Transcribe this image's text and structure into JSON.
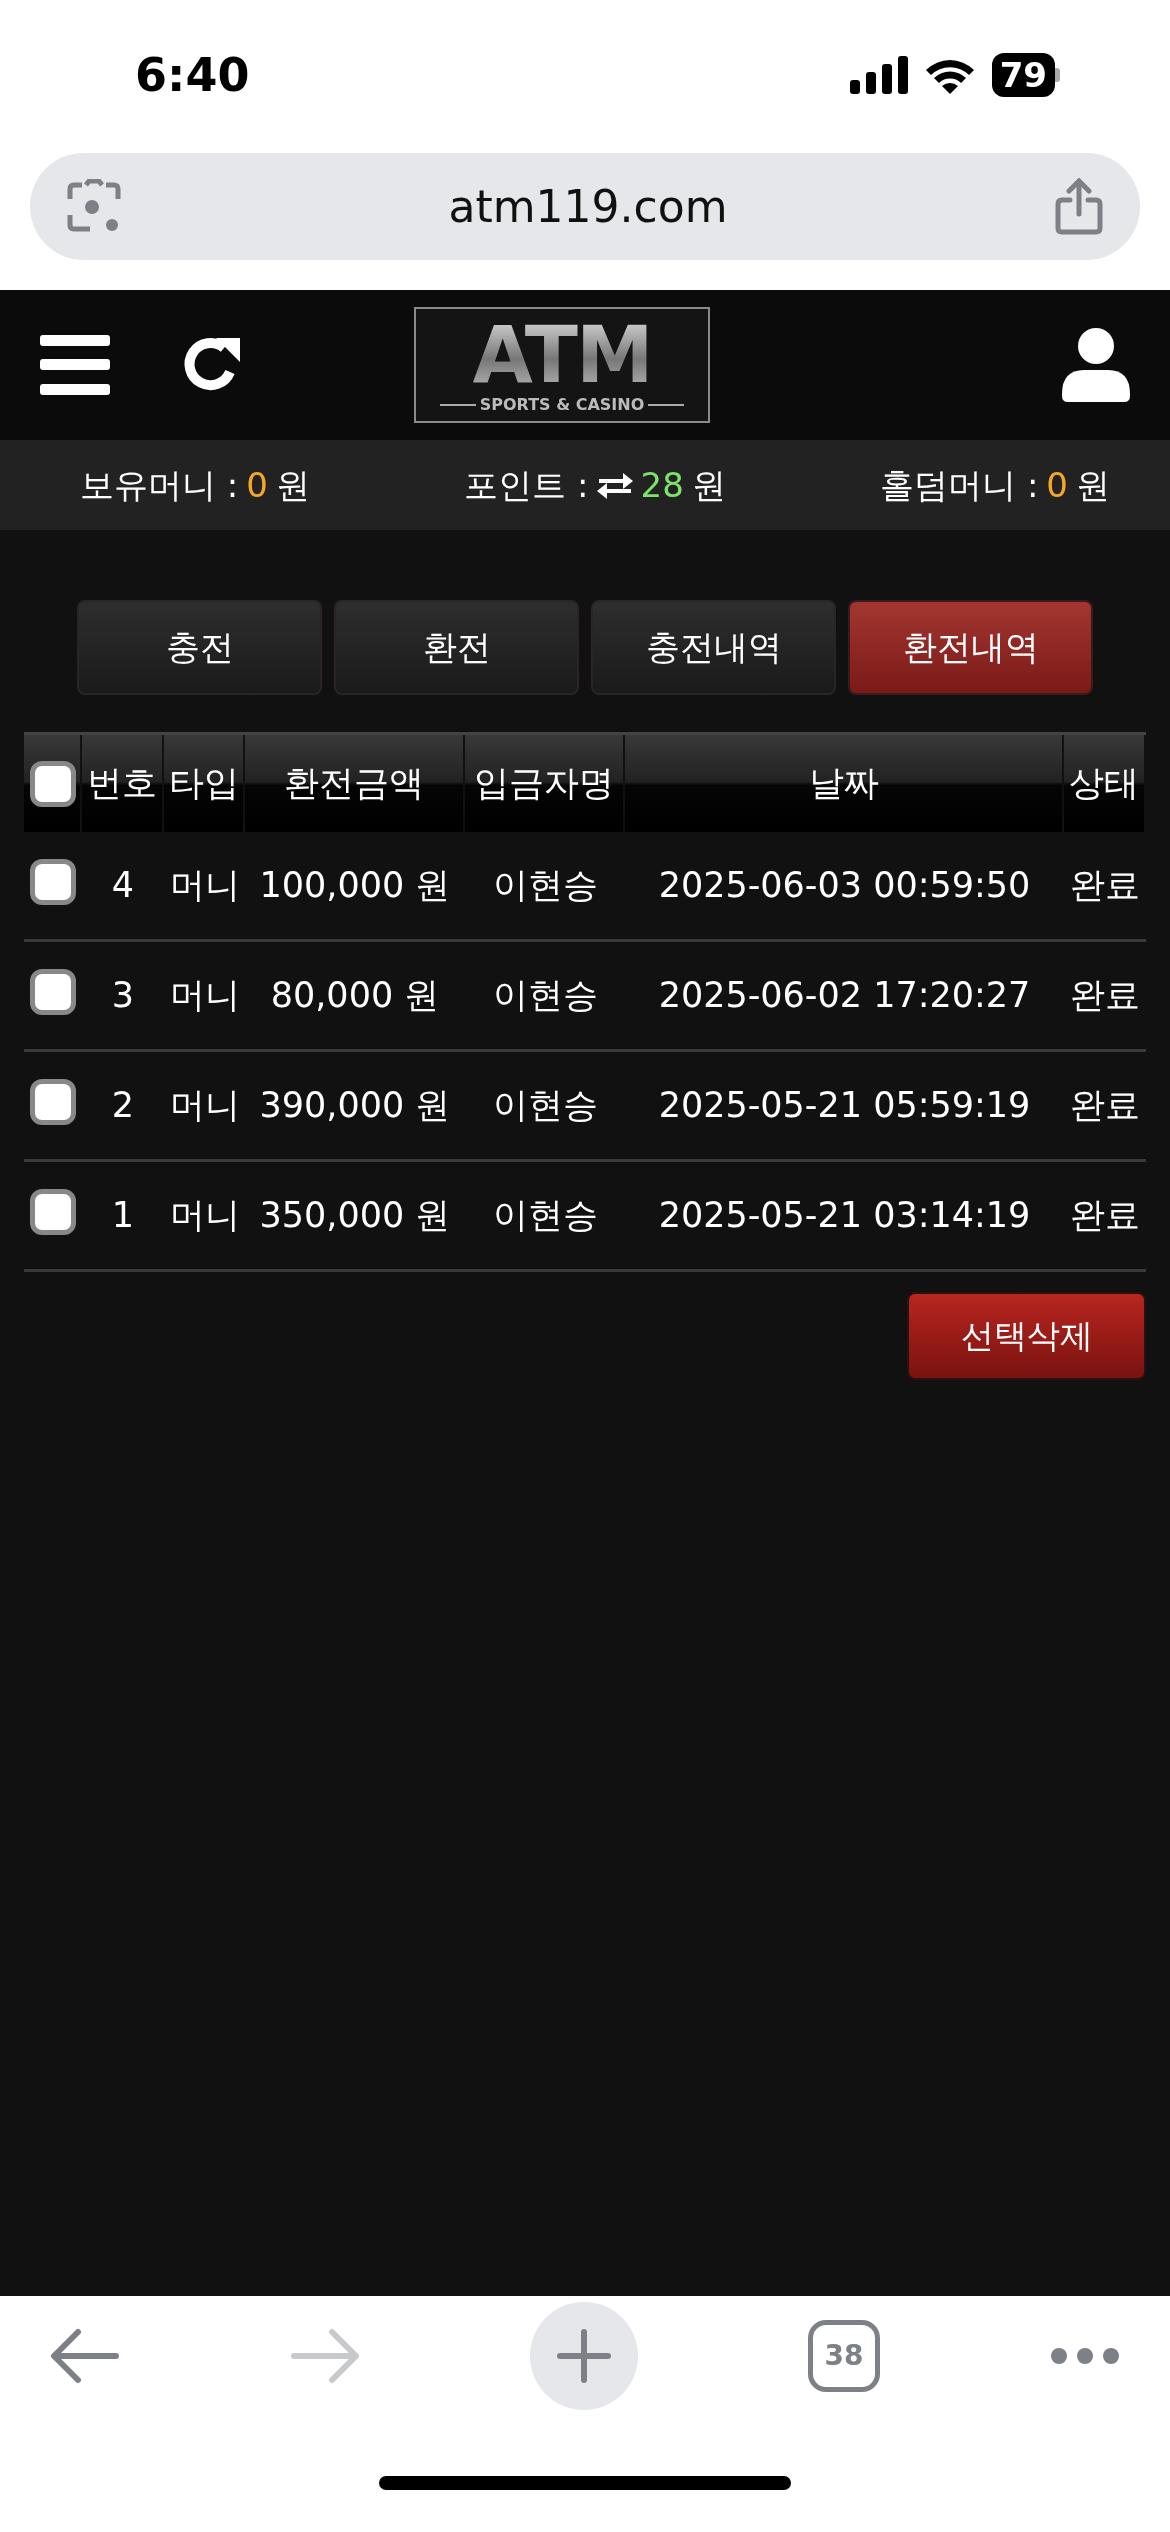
{
  "status_bar": {
    "time": "6:40",
    "battery": "79"
  },
  "browser": {
    "url": "atm119.com"
  },
  "logo": {
    "title": "ATM",
    "subtitle": "SPORTS & CASINO"
  },
  "balances": [
    {
      "kind": "money",
      "label": "보유머니 :",
      "value": "0",
      "unit": "원",
      "color": "#f5a623"
    },
    {
      "kind": "points",
      "label": "포인트 :",
      "value": "28",
      "unit": "원",
      "color": "#7ee36a"
    },
    {
      "kind": "money",
      "label": "홀덤머니 :",
      "value": "0",
      "unit": "원",
      "color": "#f5a623"
    }
  ],
  "tabs": [
    {
      "label": "충전",
      "selected": false
    },
    {
      "label": "환전",
      "selected": false
    },
    {
      "label": "충전내역",
      "selected": false
    },
    {
      "label": "환전내역",
      "selected": true
    }
  ],
  "table": {
    "select_all": {
      "checked": false
    },
    "columns": [
      "번호",
      "타입",
      "환전금액",
      "입금자명",
      "날짜",
      "상태"
    ],
    "rows": [
      {
        "checked": false,
        "cells": [
          "4",
          "머니",
          "100,000 원",
          "이현승",
          "2025-06-03 00:59:50",
          "완료"
        ]
      },
      {
        "checked": false,
        "cells": [
          "3",
          "머니",
          "80,000 원",
          "이현승",
          "2025-06-02 17:20:27",
          "완료"
        ]
      },
      {
        "checked": false,
        "cells": [
          "2",
          "머니",
          "390,000 원",
          "이현승",
          "2025-05-21 05:59:19",
          "완료"
        ]
      },
      {
        "checked": false,
        "cells": [
          "1",
          "머니",
          "350,000 원",
          "이현승",
          "2025-05-21 03:14:19",
          "완료"
        ]
      }
    ]
  },
  "delete_button": "선택삭제",
  "toolbar": [
    {
      "kind": "back",
      "disabled": false
    },
    {
      "kind": "forward",
      "disabled": true
    },
    {
      "kind": "new-tab",
      "disabled": false
    },
    {
      "kind": "tabs",
      "label": "38",
      "disabled": false
    },
    {
      "kind": "more",
      "disabled": false
    }
  ]
}
